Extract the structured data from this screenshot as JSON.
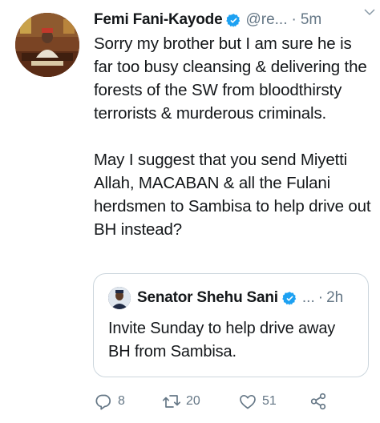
{
  "tweet": {
    "author": {
      "name": "Femi Fani-Kayode",
      "handle": "@re...",
      "separator": "·",
      "time": "5m",
      "verified": true,
      "avatar": "avatar-photo"
    },
    "text": [
      "Sorry my brother but I am sure he is far too busy cleansing & delivering the forests of the SW from bloodthirsty terrorists & murderous criminals.",
      "May I suggest that you send Miyetti Allah, MACABAN & all the Fulani herdsmen to Sambisa to help drive out BH instead?"
    ],
    "menu_icon": "chevron-down-icon",
    "quoted": {
      "name": "Senator Shehu Sani",
      "handle": "...",
      "separator": "·",
      "time": "2h",
      "verified": true,
      "avatar": "avatar-photo",
      "text": "Invite Sunday to help drive away BH from Sambisa."
    },
    "actions": {
      "replies": {
        "icon": "reply-icon",
        "count": "8"
      },
      "retweets": {
        "icon": "retweet-icon",
        "count": "20"
      },
      "likes": {
        "icon": "heart-icon",
        "count": "51"
      },
      "share": {
        "icon": "share-icon"
      }
    }
  },
  "colors": {
    "text": "#14171a",
    "secondary": "#657786",
    "verified": "#1da1f2",
    "border": "#ccd6dd"
  }
}
